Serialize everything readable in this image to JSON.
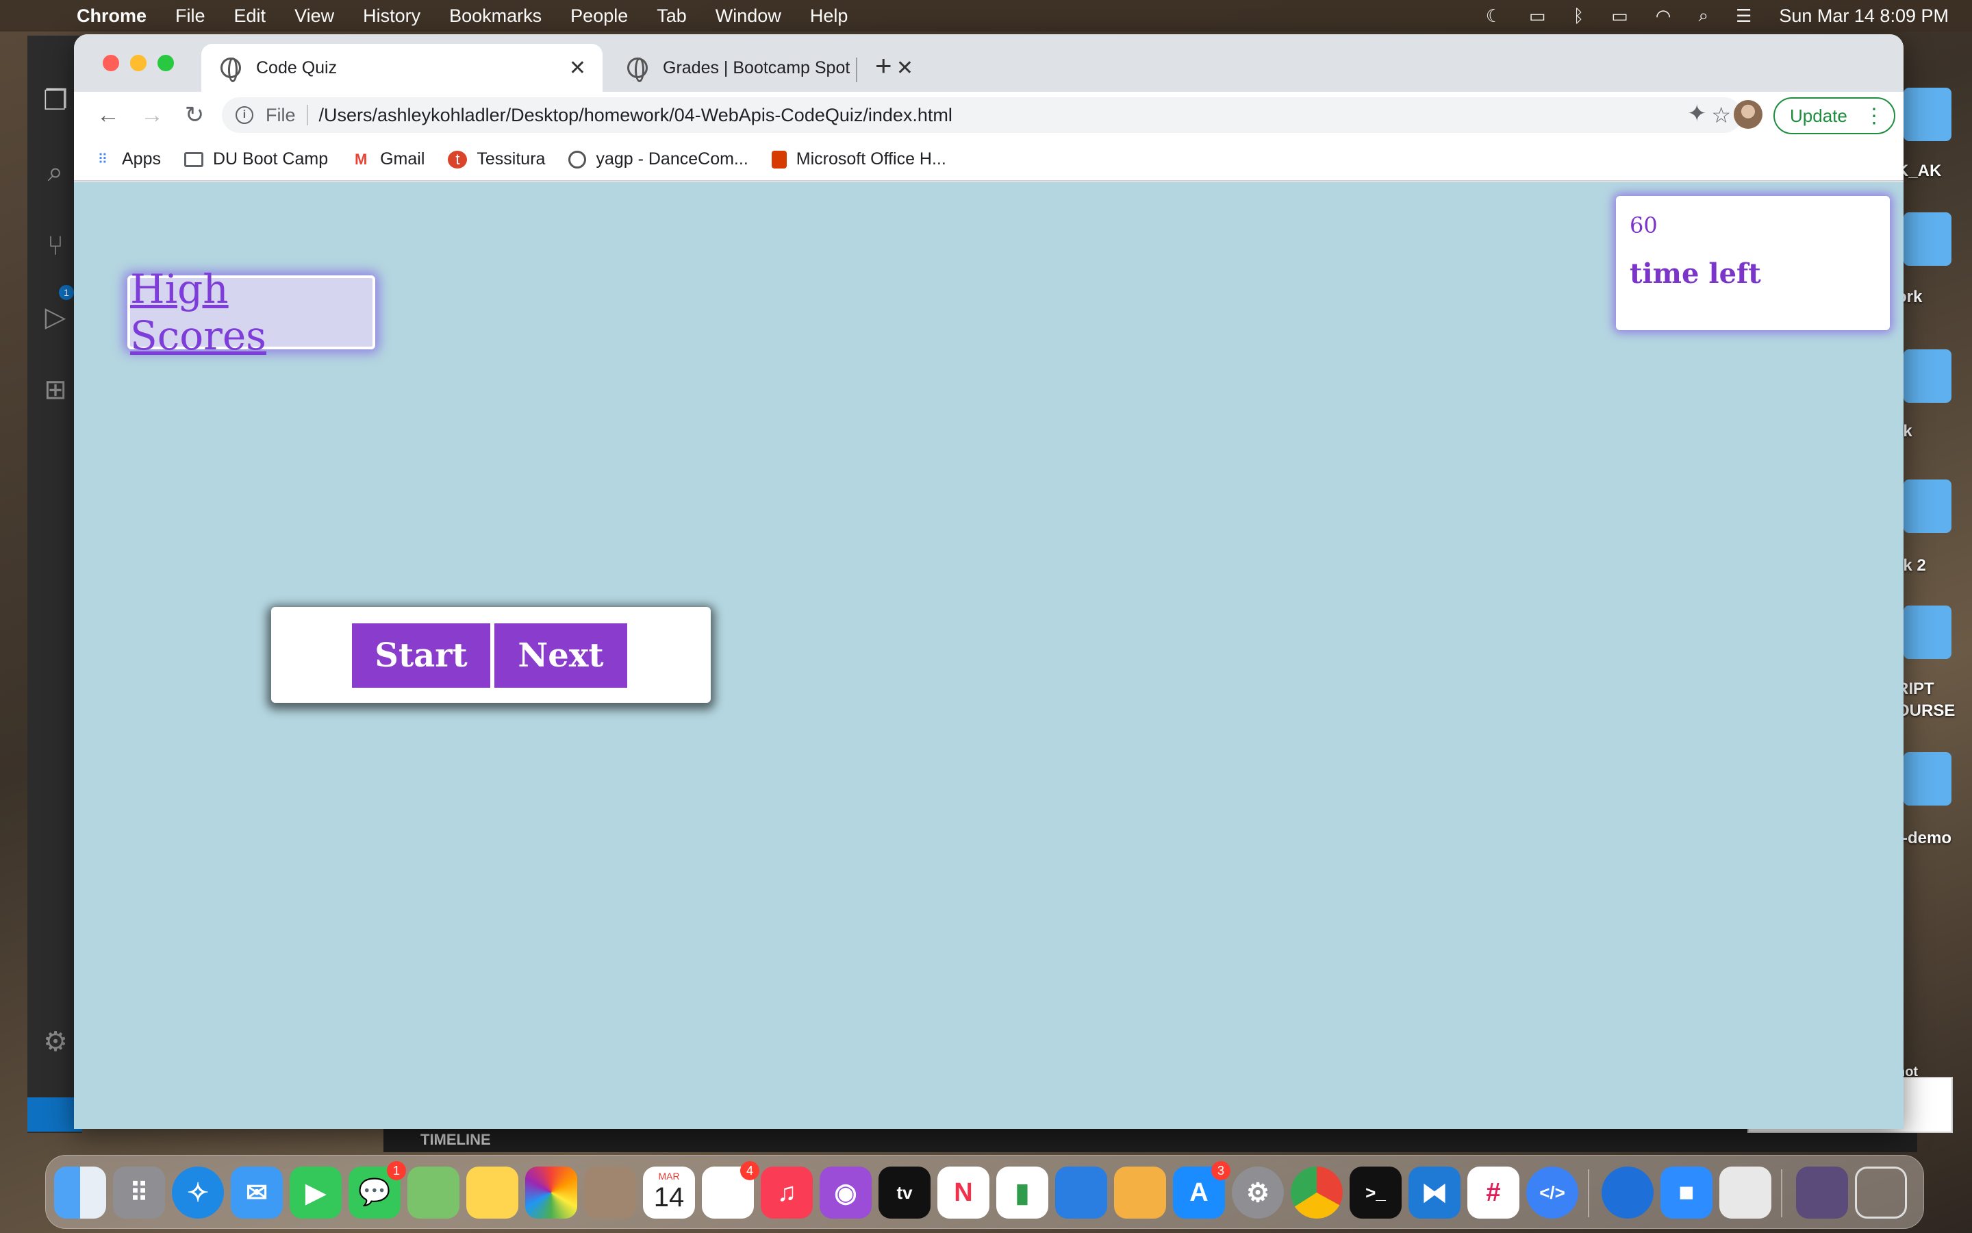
{
  "menubar": {
    "app_name": "Chrome",
    "items": [
      "File",
      "Edit",
      "View",
      "History",
      "Bookmarks",
      "People",
      "Tab",
      "Window",
      "Help"
    ],
    "clock": "Sun Mar 14  8:09 PM"
  },
  "browser": {
    "tabs": [
      {
        "title": "Code Quiz",
        "active": true
      },
      {
        "title": "Grades | Bootcamp Spot",
        "active": false
      }
    ],
    "address": {
      "scheme": "File",
      "url": "/Users/ashleykohladler/Desktop/homework/04-WebApis-CodeQuiz/index.html"
    },
    "update_label": "Update",
    "bookmarks": [
      {
        "label": "Apps",
        "icon": "apps-grid-icon"
      },
      {
        "label": "DU Boot Camp",
        "icon": "folder-icon"
      },
      {
        "label": "Gmail",
        "icon": "gmail-icon"
      },
      {
        "label": "Tessitura",
        "icon": "tessitura-icon"
      },
      {
        "label": "yagp - DanceCom...",
        "icon": "globe-icon"
      },
      {
        "label": "Microsoft Office H...",
        "icon": "office-icon"
      }
    ]
  },
  "page": {
    "high_scores_label": "High Scores",
    "timer_value": "60",
    "timer_label": "time left",
    "start_label": "Start",
    "next_label": "Next",
    "colors": {
      "background": "#b4d6e0",
      "accent": "#8a3ccc",
      "link": "#7e3cd8"
    }
  },
  "vscode": {
    "timeline_label": "TIMELINE",
    "scm_badge": "1"
  },
  "desktop": {
    "labels": [
      "K_AK",
      "ork",
      "rk",
      "rk 2",
      "RIPT",
      "OURSE",
      "t-demo",
      "hot"
    ]
  },
  "dock": {
    "badges": {
      "messages": "1",
      "reminders": "4",
      "app_store": "3"
    },
    "calendar": {
      "month": "MAR",
      "day": "14"
    }
  }
}
